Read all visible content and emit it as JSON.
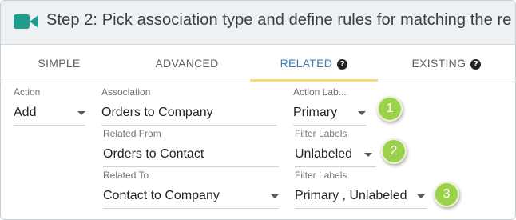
{
  "header": {
    "title": "Step 2: Pick association type and define rules for matching the re",
    "icon": "video-camera-icon",
    "icon_color": "#1e9c8e"
  },
  "tabs": [
    {
      "label": "SIMPLE",
      "active": false,
      "help": false
    },
    {
      "label": "ADVANCED",
      "active": false,
      "help": false
    },
    {
      "label": "RELATED",
      "active": true,
      "help": true
    },
    {
      "label": "EXISTING",
      "active": false,
      "help": true
    }
  ],
  "help_glyph": "?",
  "fields": {
    "action": {
      "label": "Action",
      "value": "Add"
    },
    "association": {
      "label": "Association",
      "value": "Orders to Company"
    },
    "action_labels": {
      "label": "Action Lab...",
      "value": "Primary"
    },
    "related_from": {
      "label": "Related From",
      "value": "Orders to Contact"
    },
    "filter_labels_1": {
      "label": "Filter Labels",
      "value": "Unlabeled"
    },
    "related_to": {
      "label": "Related To",
      "value": "Contact to Company"
    },
    "filter_labels_2": {
      "label": "Filter Labels",
      "value": "Primary , Unlabeled"
    }
  },
  "badges": [
    "1",
    "2",
    "3"
  ],
  "colors": {
    "accent_tab": "#3e7fb5",
    "tab_underline": "#f3dc78",
    "badge": "#9bd14b"
  }
}
